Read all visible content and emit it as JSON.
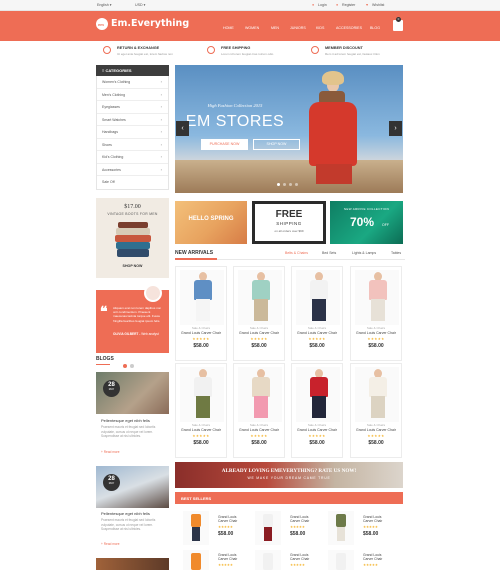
{
  "topbar": {
    "language": "English",
    "currency": "USD",
    "login": "Login",
    "register": "Register",
    "wishlist": "Wishlist"
  },
  "header": {
    "logo_text": "Em.Everything",
    "logo_badge": "em",
    "nav": [
      "HOME",
      "WOMEN",
      "MEN",
      "JUNIORS",
      "KIDS",
      "ACCESSORIES",
      "BLOG"
    ],
    "cart_count": "0"
  },
  "features": [
    {
      "title": "RETURN & EXCHANGE",
      "sub": "Ut eget ante feugiat est, lorem faubos non"
    },
    {
      "title": "FREE SHIPPING",
      "sub": "Lorem id lorem feugiat cras rutrum odio"
    },
    {
      "title": "MEMBER DISCOUNT",
      "sub": "Rem it ad lorem feugiat est, fautaux trilon"
    }
  ],
  "sidebar": {
    "categories_title": "CATEGORIES",
    "items": [
      "Women's Clothing",
      "Men's Clothing",
      "Eyeglasses",
      "Smart Watches",
      "Handbags",
      "Shoes",
      "Kid's Clothing",
      "Accessories",
      "Sale Off"
    ],
    "promo": {
      "price": "$17.00",
      "caption": "VINTAGE BOOTS FOR MEN",
      "button": "SHOP NOW"
    },
    "testimonial": {
      "quote": "Aliquam erat non lorem dapibus non orci condimentum. Praesent maecenas lacinia torque elit. Fusce fringilla faucibus feugiat ipsum felis.",
      "name": "OLIVIA GILBERT",
      "role": "Web analyst"
    }
  },
  "hero": {
    "subtitle": "High Fashion Collection 2015",
    "title": "EM STORES",
    "purchase_button": "PURCHASE NOW",
    "shop_button": "SHOP NOW",
    "prev": "‹",
    "next": "›"
  },
  "banners": {
    "spring": "HELLO SPRING",
    "free_title": "FREE",
    "free_sub": "SHIPPING",
    "free_note": "on all orders over $99",
    "new_coll": "NEW ARRIVE COLLECTION",
    "percent": "70%",
    "off": "OFF"
  },
  "new_arrivals": {
    "title": "NEW ARRIVALS",
    "tabs": [
      "Belts & Chains",
      "Bed Sets",
      "Lights & Lamps",
      "Tables"
    ],
    "products": [
      {
        "cat": "Sale & Chairs",
        "name": "Grand Louis Carver Chair",
        "price": "$58.00",
        "stars": "★★★★★"
      },
      {
        "cat": "Sale & Chairs",
        "name": "Grand Louis Carver Chair",
        "price": "$58.00",
        "stars": "★★★★★"
      },
      {
        "cat": "Sale & Chairs",
        "name": "Grand Louis Carver Chair",
        "price": "$58.00",
        "stars": "★★★★★"
      },
      {
        "cat": "Sale & Chairs",
        "name": "Grand Louis Carver Chair",
        "price": "$58.00",
        "stars": "★★★★★"
      },
      {
        "cat": "Sale & Chairs",
        "name": "Grand Louis Carver Chair",
        "price": "$58.00",
        "stars": "★★★★★"
      },
      {
        "cat": "Sale & Chairs",
        "name": "Grand Louis Carver Chair",
        "price": "$58.00",
        "stars": "★★★★★"
      },
      {
        "cat": "Sale & Chairs",
        "name": "Grand Louis Carver Chair",
        "price": "$58.00",
        "stars": "★★★★★"
      },
      {
        "cat": "Sale & Chairs",
        "name": "Grand Louis Carver Chair",
        "price": "$58.00",
        "stars": "★★★★★"
      }
    ]
  },
  "rate_banner": {
    "title": "ALREADY LOVING EMEVERYTHING? RATE US NOW!",
    "sub": "WE MAKE YOUR DREAM CAME TRUE"
  },
  "blogs": {
    "title": "BLOGS",
    "posts": [
      {
        "day": "28",
        "month": "MAY",
        "title": "Pellentesque eget nibh felis",
        "text": "Praesent mauris et feugiat sed lobortis vulputate, cursus ut neque vel lorem. Suspendisse at nisl ultricies.",
        "read": "+ Read more"
      },
      {
        "day": "28",
        "month": "MAY",
        "title": "Pellentesque eget nibh felis",
        "text": "Praesent mauris et feugiat sed lobortis vulputate, cursus ut neque vel lorem. Suspendisse at nisl ultricies.",
        "read": "+ Read more"
      }
    ]
  },
  "best_sellers": {
    "title": "BEST SELLERS",
    "items": [
      {
        "name": "Grand Louis Carver Chair",
        "price": "$58.00",
        "stars": "★★★★★"
      },
      {
        "name": "Grand Louis Carver Chair",
        "price": "$58.00",
        "stars": "★★★★★"
      },
      {
        "name": "Grand Louis Carver Chair",
        "price": "$58.00",
        "stars": "★★★★★"
      },
      {
        "name": "Grand Louis Carver Chair",
        "price": "$58.00",
        "stars": "★★★★★"
      },
      {
        "name": "Grand Louis Carver Chair",
        "price": "",
        "stars": "★★★★★"
      },
      {
        "name": "Grand Louis Carver Chair",
        "price": "",
        "stars": "★★★★★"
      },
      {
        "name": "Grand Louis Carver Chair",
        "price": "",
        "stars": "★★★★★"
      },
      {
        "name": "Grand Louis Carver Chair",
        "price": "",
        "stars": "★★★★★"
      }
    ]
  },
  "colors": {
    "accent": "#ee6d55",
    "dark": "#3d3d3d",
    "star": "#f5b32a"
  }
}
